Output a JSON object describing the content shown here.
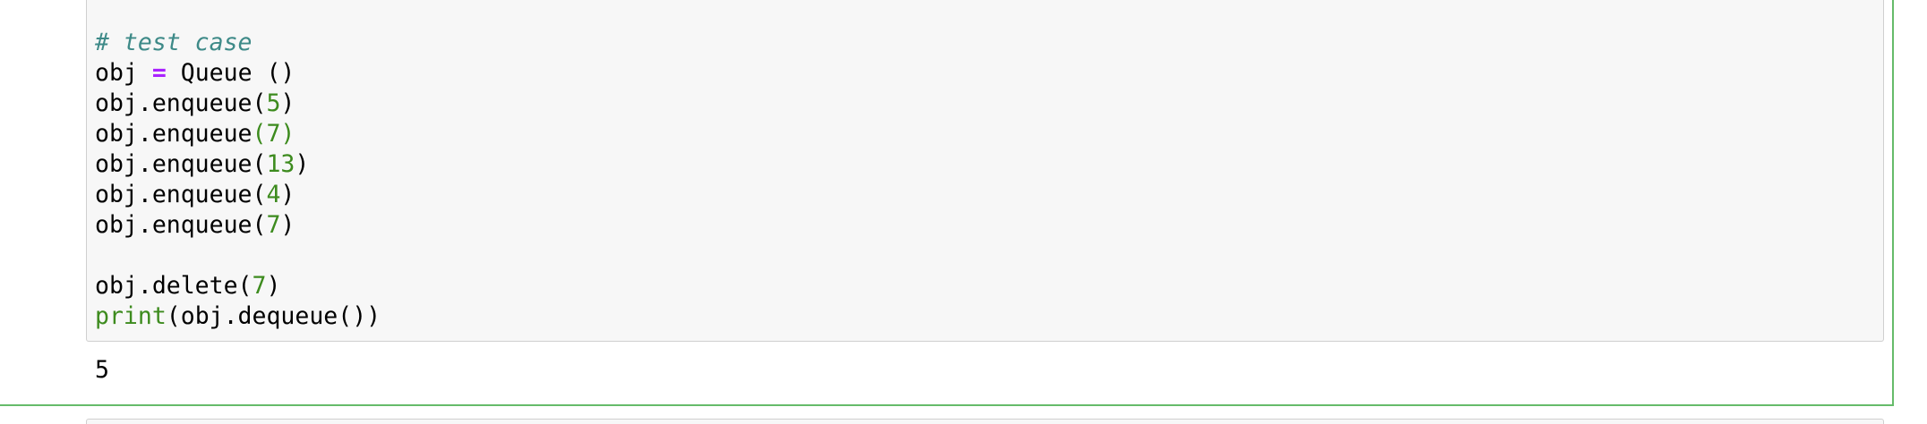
{
  "cell": {
    "code_lines": [
      [
        {
          "t": "# test case",
          "k": "comment"
        }
      ],
      [
        {
          "t": "obj ",
          "k": "text"
        },
        {
          "t": "=",
          "k": "op"
        },
        {
          "t": " Queue ()",
          "k": "text"
        }
      ],
      [
        {
          "t": "obj.enqueue(",
          "k": "text"
        },
        {
          "t": "5",
          "k": "num"
        },
        {
          "t": ")",
          "k": "text"
        }
      ],
      [
        {
          "t": "obj.enqueue",
          "k": "text"
        },
        {
          "t": "(7)",
          "k": "num"
        }
      ],
      [
        {
          "t": "obj.enqueue(",
          "k": "text"
        },
        {
          "t": "13",
          "k": "num"
        },
        {
          "t": ")",
          "k": "text"
        }
      ],
      [
        {
          "t": "obj.enqueue(",
          "k": "text"
        },
        {
          "t": "4",
          "k": "num"
        },
        {
          "t": ")",
          "k": "text"
        }
      ],
      [
        {
          "t": "obj.enqueue(",
          "k": "text"
        },
        {
          "t": "7",
          "k": "num"
        },
        {
          "t": ")",
          "k": "text"
        }
      ],
      [],
      [
        {
          "t": "obj.delete(",
          "k": "text"
        },
        {
          "t": "7",
          "k": "num"
        },
        {
          "t": ")",
          "k": "text"
        }
      ],
      [
        {
          "t": "print",
          "k": "builtin"
        },
        {
          "t": "(obj.dequeue())",
          "k": "text"
        }
      ]
    ],
    "output": "5"
  },
  "colors": {
    "comment": "#3e8a88",
    "operator": "#aa22ff",
    "number": "#3d8b1e",
    "builtin": "#3d8b1e",
    "selected_cell_border": "#66bb6a",
    "input_background": "#f7f7f7"
  }
}
